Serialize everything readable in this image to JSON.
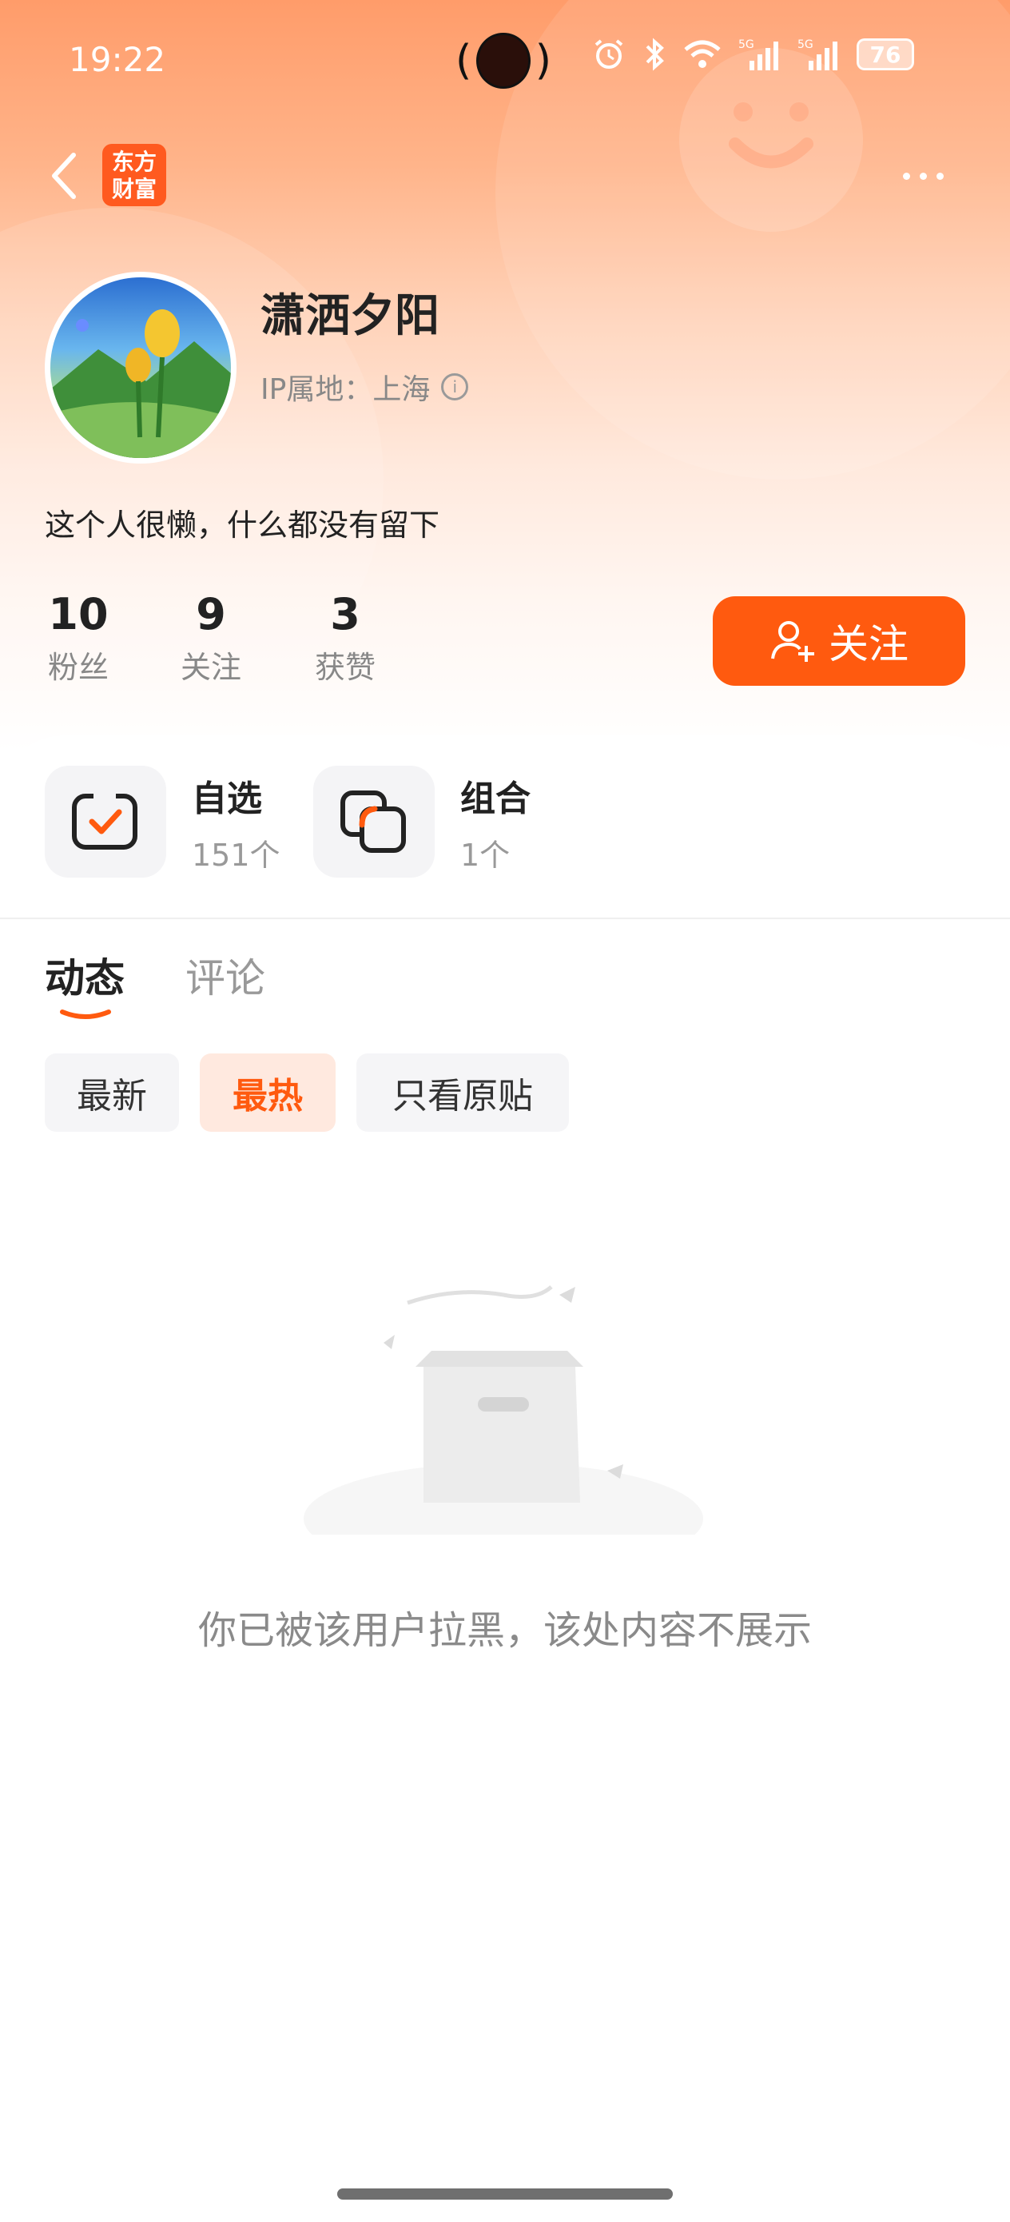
{
  "status_bar": {
    "time": "19:22",
    "battery": "76",
    "signal_1": "5G",
    "signal_2": "5G"
  },
  "header": {
    "logo_line1": "东方",
    "logo_line2": "财富"
  },
  "profile": {
    "name": "潇洒夕阳",
    "ip_location": "IP属地：上海",
    "bio": "这个人很懒，什么都没有留下",
    "stats": [
      {
        "value": "10",
        "label": "粉丝"
      },
      {
        "value": "9",
        "label": "关注"
      },
      {
        "value": "3",
        "label": "获赞"
      }
    ],
    "follow_label": "关注"
  },
  "portfolio": [
    {
      "title": "自选",
      "count": "151个",
      "icon": "checkbox-check-icon"
    },
    {
      "title": "组合",
      "count": "1个",
      "icon": "overlapping-squares-icon"
    }
  ],
  "tabs": [
    {
      "label": "动态",
      "active": true
    },
    {
      "label": "评论",
      "active": false
    }
  ],
  "filters": [
    {
      "label": "最新",
      "active": false
    },
    {
      "label": "最热",
      "active": true
    },
    {
      "label": "只看原贴",
      "active": false
    }
  ],
  "empty_state": {
    "message": "你已被该用户拉黑，该处内容不展示"
  },
  "colors": {
    "accent": "#ff5a0f",
    "hero_top": "#ff9c6a"
  }
}
